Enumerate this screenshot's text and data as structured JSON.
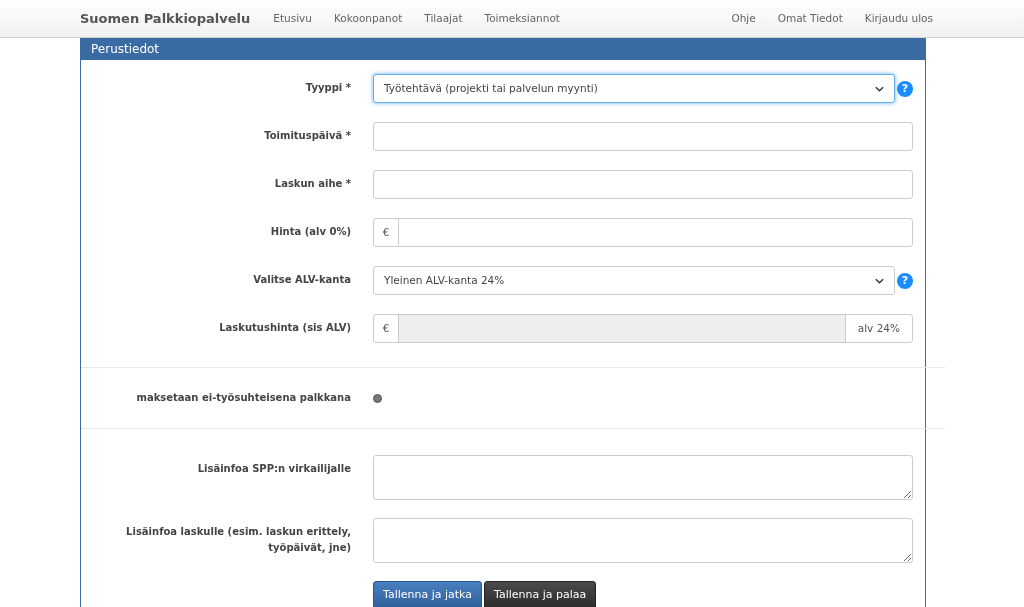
{
  "navbar": {
    "brand": "Suomen Palkkiopalvelu",
    "left_links": [
      "Etusivu",
      "Kokoonpanot",
      "Tilaajat",
      "Toimeksiannot"
    ],
    "right_links": [
      "Ohje",
      "Omat Tiedot",
      "Kirjaudu ulos"
    ]
  },
  "panel": {
    "title": "Perustiedot"
  },
  "sections": [
    {
      "fields": [
        {
          "kind": "select",
          "label": "Tyyppi *",
          "value": "Työtehtävä (projekti tai palvelun myynti)",
          "focused": true,
          "help": "?"
        },
        {
          "kind": "input",
          "label": "Toimituspäivä *"
        },
        {
          "kind": "input",
          "label": "Laskun aihe *"
        },
        {
          "kind": "prefix",
          "label": "Hinta (alv 0%)",
          "prefix": "€"
        },
        {
          "kind": "select",
          "label": "Valitse ALV-kanta",
          "value": "Yleinen ALV-kanta 24%",
          "focused": false,
          "help": "?"
        },
        {
          "kind": "readonly",
          "label": "Laskutushinta (sis ALV)",
          "prefix": "€",
          "suffix": "alv 24%"
        }
      ]
    },
    {
      "fields": [
        {
          "kind": "toggle",
          "label": "maksetaan ei-työsuhteisena palkkana",
          "checked": true
        }
      ]
    },
    {
      "fields": [
        {
          "kind": "textarea",
          "label": "Lisäinfoa SPP:n virkailijalle"
        },
        {
          "kind": "textarea",
          "label": "Lisäinfoa laskulle (esim. laskun erittely, työpäivät, jne)"
        }
      ]
    }
  ],
  "buttons": [
    {
      "label": "Tallenna ja jatka",
      "kind": "primary"
    },
    {
      "label": "Tallenna ja palaa",
      "kind": "dark"
    }
  ]
}
